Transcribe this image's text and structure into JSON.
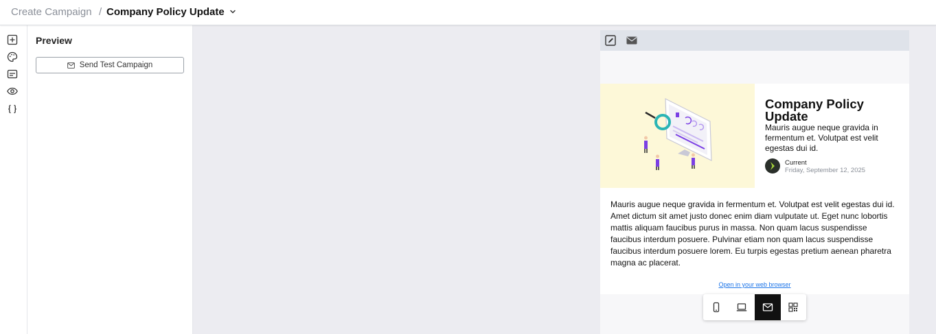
{
  "header": {
    "breadcrumb_root": "Create Campaign",
    "separator": "/",
    "campaign_name": "Company Policy Update",
    "dropdown_icon": "chevron-down-icon"
  },
  "rail": {
    "items": [
      {
        "icon": "add-block-icon"
      },
      {
        "icon": "palette-icon"
      },
      {
        "icon": "form-icon"
      },
      {
        "icon": "eye-icon"
      },
      {
        "icon": "code-braces-icon"
      }
    ]
  },
  "panel": {
    "title": "Preview",
    "send_test_label": "Send Test Campaign",
    "send_test_icon": "envelope-icon"
  },
  "preview": {
    "toolbar": {
      "edit_icon": "edit-icon",
      "mail_icon": "envelope-icon"
    },
    "hero": {
      "title": "Company Policy Update",
      "subtitle": "Mauris augue neque gravida in fermentum et. Volutpat est velit egestas dui id.",
      "author_name": "Current",
      "author_date": "Friday, September 12, 2025",
      "image_bg": "#fdf8d8"
    },
    "body": "Mauris augue neque gravida in fermentum et. Volutpat est velit egestas dui id. Amet dictum sit amet justo donec enim diam vulputate ut. Eget nunc lobortis mattis aliquam faucibus purus in massa. Non quam lacus suspendisse faucibus interdum posuere. Pulvinar etiam non quam lacus suspendisse faucibus interdum posuere lorem. Eu turpis egestas pretium aenean pharetra magna ac placerat.",
    "web_link": "Open in your web browser"
  },
  "device_switcher": {
    "options": [
      {
        "icon": "mobile-icon",
        "active": false
      },
      {
        "icon": "laptop-icon",
        "active": false
      },
      {
        "icon": "email-icon",
        "active": true
      },
      {
        "icon": "grid-icon",
        "active": false
      }
    ]
  },
  "colors": {
    "canvas_bg": "#ececf1",
    "link": "#1a73e8",
    "accent_teal": "#2bb5b5",
    "accent_purple": "#7b3fe4"
  }
}
